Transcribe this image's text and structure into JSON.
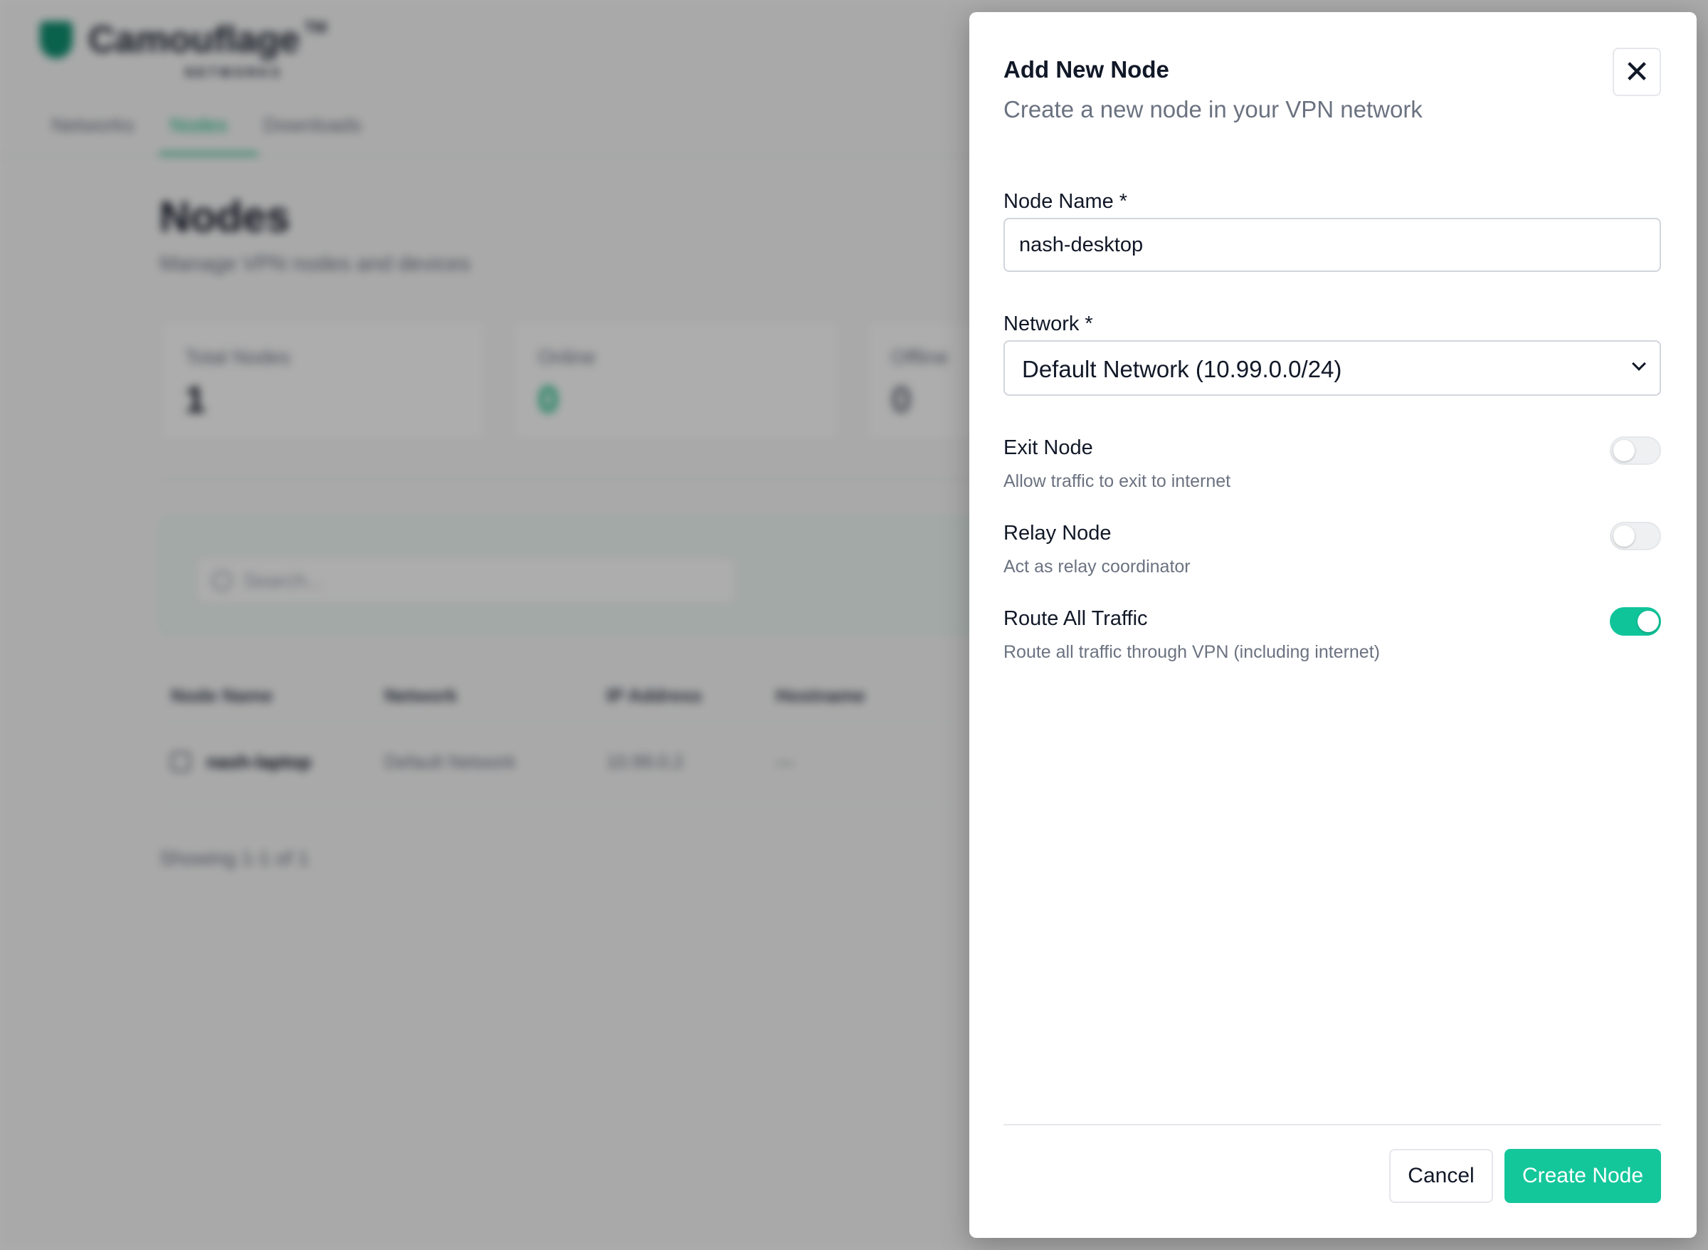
{
  "app": {
    "logo_text": "Camouflage",
    "logo_tm": "TM",
    "logo_sub": "NETWORKS",
    "nav": [
      "Networks",
      "Nodes",
      "Downloads"
    ],
    "page_title": "Nodes",
    "page_subtitle": "Manage VPN nodes and devices",
    "stats": [
      {
        "label": "Total Nodes",
        "value": "1"
      },
      {
        "label": "Online",
        "value": "0"
      },
      {
        "label": "Offline",
        "value": "0"
      }
    ],
    "search_placeholder": "Search...",
    "table": {
      "headers": [
        "Node Name",
        "Network",
        "IP Address",
        "Hostname"
      ],
      "rows": [
        {
          "name": "nash-laptop",
          "network": "Default Network",
          "ip": "10.99.0.2",
          "hostname": "—"
        }
      ]
    },
    "showing": "Showing 1-1 of 1"
  },
  "modal": {
    "title": "Add New Node",
    "subtitle": "Create a new node in your VPN network",
    "close_icon": "close-icon",
    "node_name": {
      "label": "Node Name *",
      "value": "nash-desktop"
    },
    "network": {
      "label": "Network *",
      "value": "Default Network (10.99.0.0/24)"
    },
    "toggles": [
      {
        "label": "Exit Node",
        "description": "Allow traffic to exit to internet",
        "on": false
      },
      {
        "label": "Relay Node",
        "description": "Act as relay coordinator",
        "on": false
      },
      {
        "label": "Route All Traffic",
        "description": "Route all traffic through VPN (including internet)",
        "on": true
      }
    ],
    "cancel_label": "Cancel",
    "create_label": "Create Node"
  },
  "colors": {
    "accent": "#14c79b",
    "overlay": "rgba(0,0,0,0.32)"
  }
}
